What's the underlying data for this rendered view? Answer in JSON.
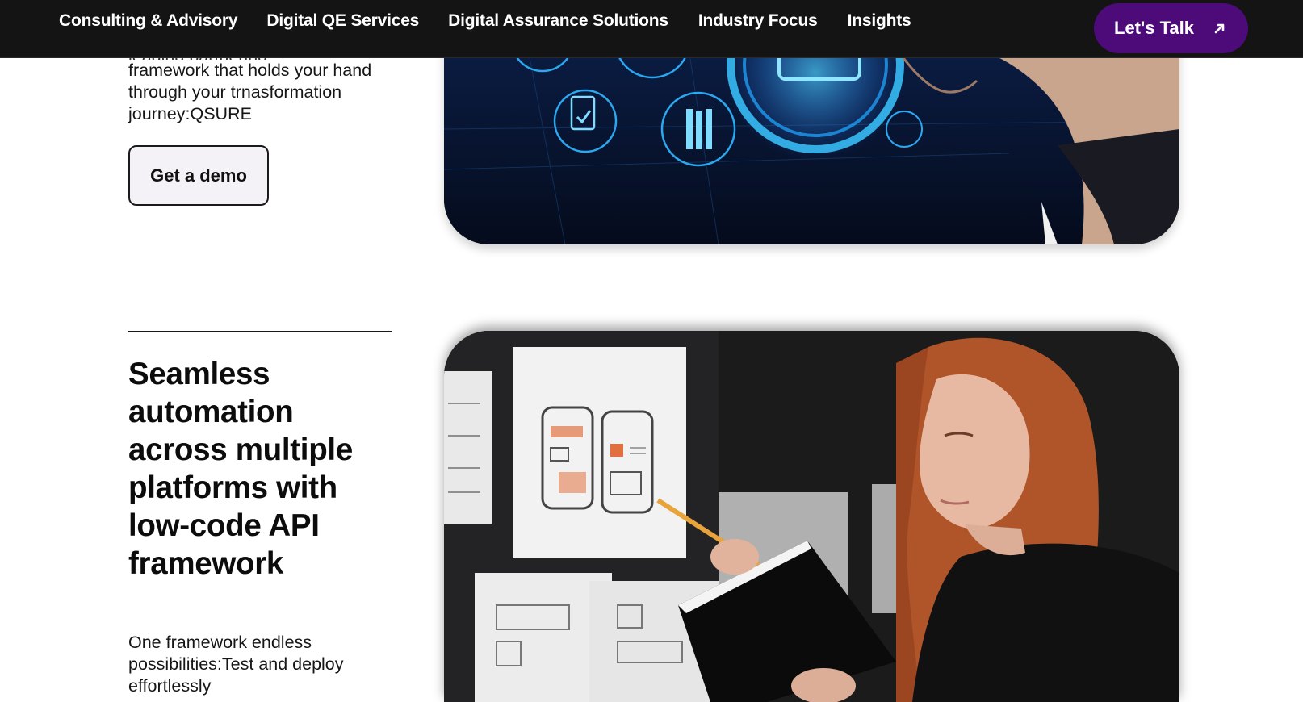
{
  "nav": {
    "items": [
      {
        "label": "Consulting & Advisory"
      },
      {
        "label": "Digital QE Services"
      },
      {
        "label": "Digital Assurance Solutions"
      },
      {
        "label": "Industry Focus"
      },
      {
        "label": "Insights"
      }
    ],
    "cta_label": "Let's Talk",
    "cta_icon": "arrow-up-right-icon"
  },
  "section1": {
    "clipped_line": "leading partnering",
    "description": "framework that holds your hand through your trnasformation journey:QSURE",
    "demo_label": "Get a demo"
  },
  "section2": {
    "heading": "Seamless automation across multiple platforms with low-code API framework",
    "description": "One framework endless possibilities:Test and deploy effortlessly"
  },
  "colors": {
    "topbar": "#141414",
    "cta": "#4d0b7a",
    "text": "#161616"
  }
}
